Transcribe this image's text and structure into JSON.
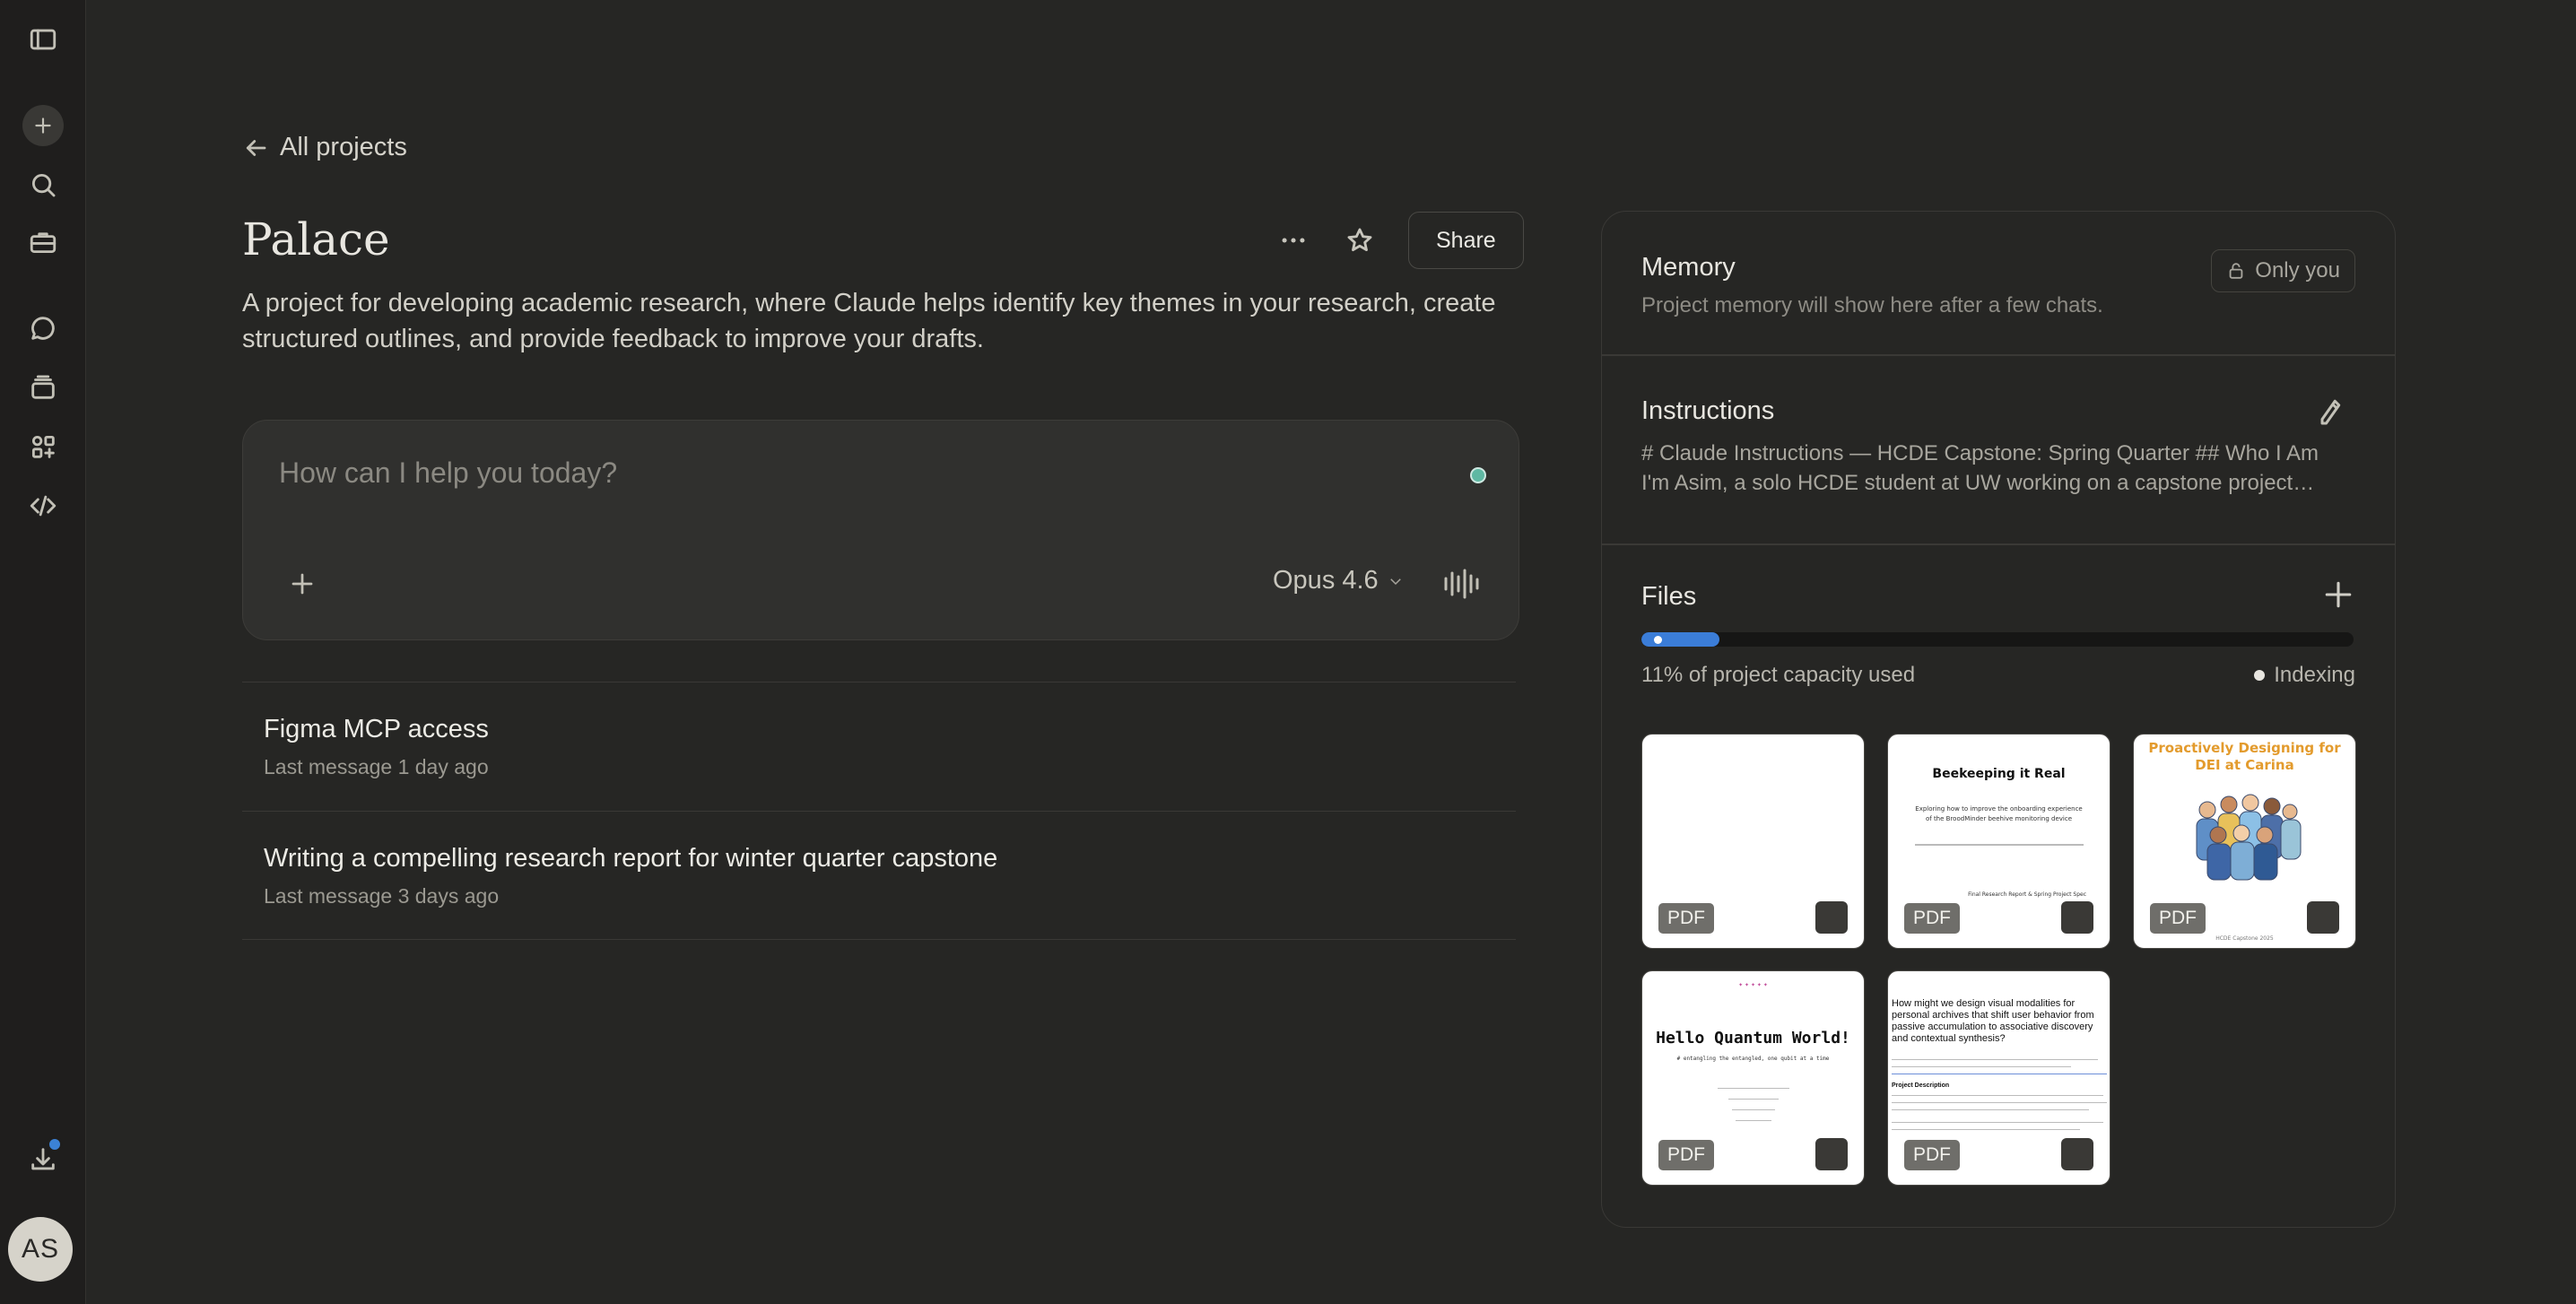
{
  "nav": {
    "back_label": "All projects"
  },
  "project": {
    "title": "Palace",
    "description": "A project for developing academic research, where Claude helps identify key themes in your research, create structured outlines, and provide feedback to improve your drafts.",
    "share_label": "Share"
  },
  "composer": {
    "placeholder": "How can I help you today?",
    "model": "Opus 4.6"
  },
  "chats": [
    {
      "title": "Figma MCP access",
      "meta": "Last message 1 day ago"
    },
    {
      "title": "Writing a compelling research report for winter quarter capstone",
      "meta": "Last message 3 days ago"
    }
  ],
  "memory": {
    "title": "Memory",
    "visibility": "Only you",
    "subtitle": "Project memory will show here after a few chats."
  },
  "instructions": {
    "title": "Instructions",
    "line1": "# Claude Instructions — HCDE Capstone: Spring Quarter ## Who I Am",
    "line2": "I'm Asim, a solo HCDE student at UW working on a capstone project…"
  },
  "files": {
    "title": "Files",
    "capacity_fraction": 0.11,
    "capacity_label": "11% of project capacity used",
    "status": "Indexing",
    "tag": "PDF",
    "items": [
      {
        "kind": "blank"
      },
      {
        "title": "Beekeeping it Real",
        "subtitle": "Exploring how to improve the onboarding experience of the BroodMinder beehive monitoring device",
        "footer": "Final Research Report & Spring Project Spec"
      },
      {
        "title": "Proactively Designing for DEI at Carina",
        "footer": "HCDE Capstone 2025"
      },
      {
        "title": "Hello Quantum World!",
        "subtitle": "# entangling the entangled, one qubit at a time"
      },
      {
        "title": "How might we design visual modalities for personal archives that shift user behavior from passive accumulation to associative discovery and contextual synthesis?",
        "section": "Project Description"
      }
    ]
  },
  "user": {
    "initials": "AS"
  },
  "colors": {
    "accent_blue": "#3b7dd8",
    "status_teal": "#5fb8a3",
    "background": "#262624"
  }
}
